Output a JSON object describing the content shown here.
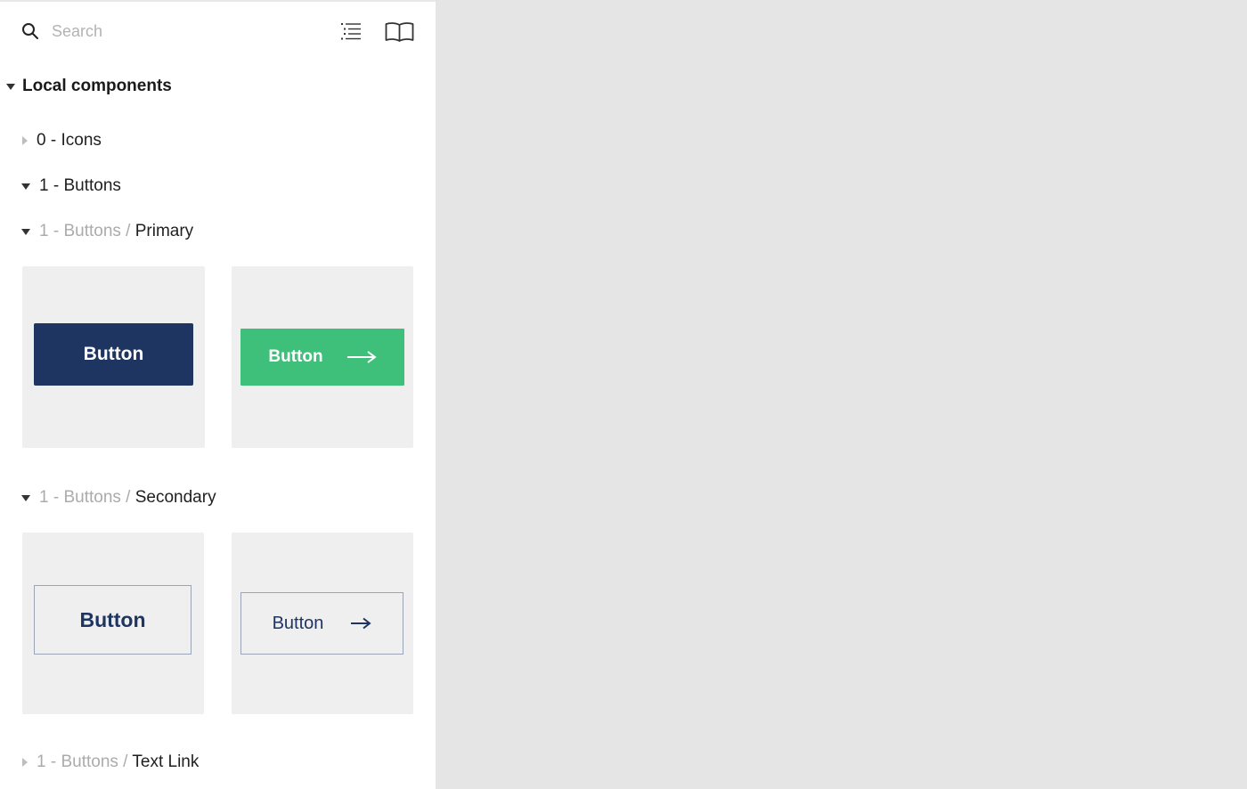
{
  "search": {
    "placeholder": "Search"
  },
  "toolbar": {
    "list_view_icon": "list-icon",
    "library_icon": "book-icon"
  },
  "section": {
    "title": "Local components",
    "expanded": true
  },
  "groups": [
    {
      "number": "0",
      "sep": " - ",
      "name": "Icons",
      "expanded": false
    },
    {
      "number": "1",
      "sep": " - ",
      "name": "Buttons",
      "expanded": true
    }
  ],
  "subgroups": {
    "primary": {
      "parent": "1 - Buttons",
      "slash": " / ",
      "name": "Primary",
      "expanded": true
    },
    "secondary": {
      "parent": "1 - Buttons",
      "slash": " / ",
      "name": "Secondary",
      "expanded": true
    },
    "text_link": {
      "parent": "1 - Buttons",
      "slash": " / ",
      "name": "Text Link",
      "expanded": false
    }
  },
  "components": {
    "primary_default": {
      "label": "Button"
    },
    "primary_arrow": {
      "label": "Button",
      "icon": "arrow-right-icon"
    },
    "secondary_default": {
      "label": "Button"
    },
    "secondary_arrow": {
      "label": "Button",
      "icon": "arrow-right-icon"
    }
  },
  "colors": {
    "navy": "#1e3461",
    "green": "#3fc07a",
    "thumb_bg": "#efefef",
    "canvas_bg": "#e5e5e5"
  }
}
